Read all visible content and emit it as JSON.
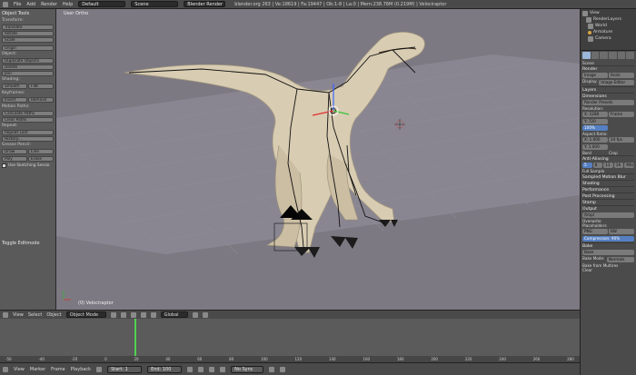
{
  "topbar": {
    "menus": [
      "File",
      "Add",
      "Render",
      "Help"
    ],
    "layout": "Default",
    "scene": "Scene",
    "engine": "Blender Render",
    "info": "blender.org 263 | Ve:18619 | Fa:19447 | Ob:1-8 | La:0 | Mem:238.76M (0.219M) | Velociraptor",
    "right_label": "Dinosaur"
  },
  "toolshelf": {
    "title": "Object Tools",
    "transform_hdr": "Transform:",
    "transform": [
      "Translate",
      "Rotate",
      "Scale"
    ],
    "origin": "Origin",
    "object_hdr": "Object:",
    "object": [
      "Duplicate Objects",
      "Delete",
      "Join"
    ],
    "shading_hdr": "Shading:",
    "shading": [
      "Smooth",
      "Flat"
    ],
    "keyframes_hdr": "Keyframes:",
    "keyframes": [
      "Insert",
      "Remove"
    ],
    "motion_hdr": "Motion Paths:",
    "motion": [
      "Calculate Paths",
      "Clear Paths"
    ],
    "repeat_hdr": "Repeat:",
    "repeat": [
      "Repeat Last",
      "History..."
    ],
    "grease_hdr": "Grease Pencil:",
    "grease": [
      "Draw",
      "Line",
      "Poly",
      "Erase"
    ],
    "sketch": "Use Sketching Sessio",
    "editmode": "Toggle Editmode"
  },
  "viewport": {
    "label": "User Ortho",
    "object": "(0) Velociraptor"
  },
  "viewport_header": {
    "menus": [
      "View",
      "Select",
      "Object"
    ],
    "mode": "Object Mode",
    "pivot": "Global"
  },
  "timeline": {
    "ruler": [
      "-50",
      "-40",
      "-20",
      "0",
      "20",
      "40",
      "60",
      "80",
      "100",
      "120",
      "140",
      "160",
      "180",
      "200",
      "220",
      "240",
      "260",
      "280"
    ]
  },
  "bottombar": {
    "menus": [
      "View",
      "Marker",
      "Frame",
      "Playback"
    ],
    "start": "Start: 1",
    "end": "End: 100",
    "sync": "No Sync"
  },
  "outliner": {
    "items": [
      "View",
      "RenderLayers",
      "World",
      "Armature",
      "Camera"
    ]
  },
  "properties": {
    "scene": "Scene",
    "render_hdr": "Render",
    "render_btns": [
      "Image",
      "Anim"
    ],
    "display": "Display:",
    "display_val": "Image Editor",
    "layers": "Layers",
    "dimensions": "Dimensions",
    "presets": "Render Presets",
    "resolution": "Resolution:",
    "res_x": "X: 1280",
    "res_y": "Y: 720",
    "res_pct": "100%",
    "aspect": "Aspect Ratio:",
    "asp_x": "X: 1.000",
    "asp_y": "Y: 1.000",
    "border": "Bord",
    "crop": "Crop",
    "frame": "Frame",
    "fps": "24 fps",
    "aa": "Anti-Aliasing",
    "aa_vals": [
      "5",
      "8",
      "11",
      "16"
    ],
    "filter": "Mitchell",
    "full_sample": "Full Sample",
    "motion_blur": "Sampled Motion Blur",
    "shading": "Shading",
    "performance": "Performance",
    "post": "Post Processing",
    "stamp": "Stamp",
    "output": "Output",
    "output_path": "/tmp/",
    "overwrite": "Overwrite",
    "placeholders": "Placeholders",
    "format": "PNG",
    "color": "BW",
    "compression": "Compression: 90%",
    "bake": "Bake",
    "bake_btn": "Bake",
    "bake_mode": "Bake Mode:",
    "bake_mode_val": "Normals",
    "bake_multires": "Bake from Multires",
    "clear": "Clear"
  }
}
